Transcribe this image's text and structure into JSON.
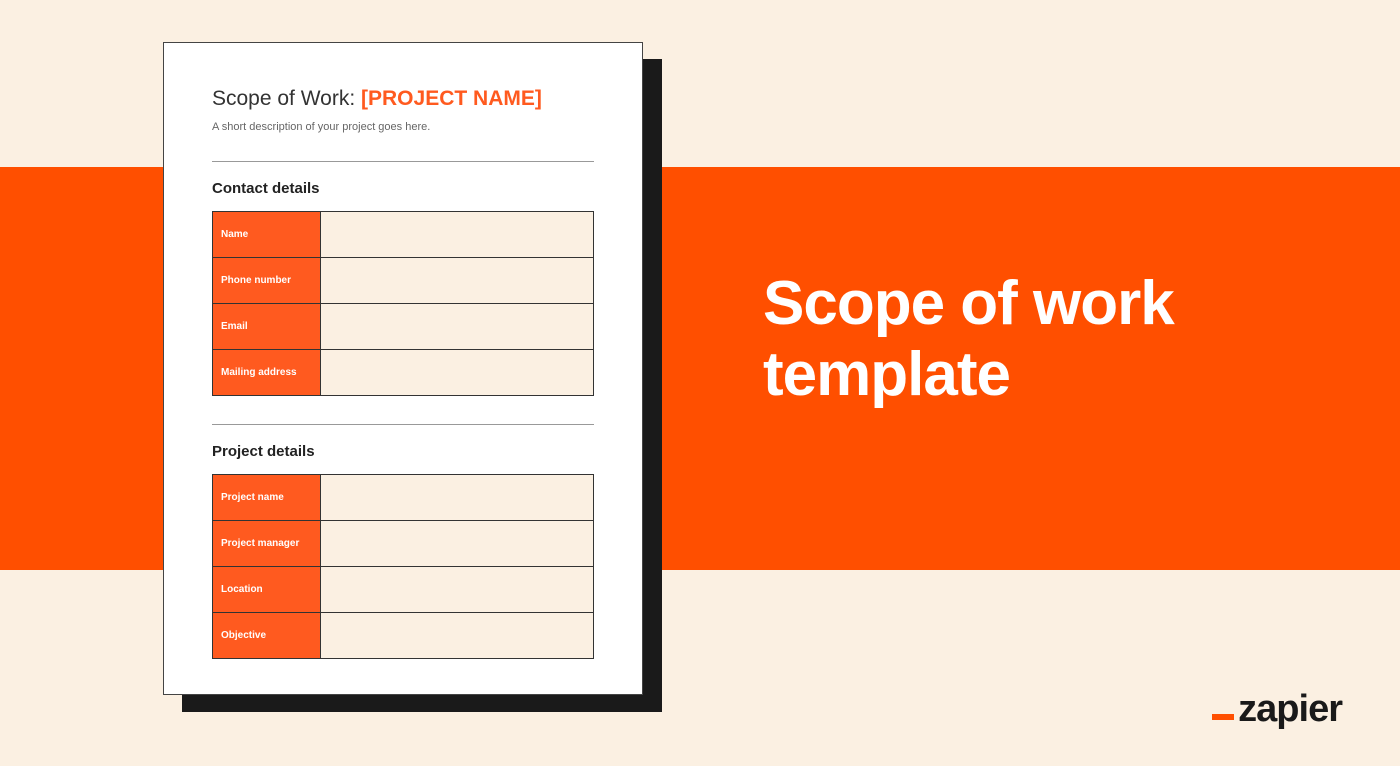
{
  "headline": "Scope of work template",
  "brand": "zapier",
  "document": {
    "title_prefix": "Scope of Work: ",
    "title_placeholder": "[PROJECT NAME]",
    "subtitle": "A short description of your project goes here.",
    "sections": [
      {
        "heading": "Contact details",
        "rows": [
          {
            "label": "Name",
            "value": ""
          },
          {
            "label": "Phone number",
            "value": ""
          },
          {
            "label": "Email",
            "value": ""
          },
          {
            "label": "Mailing address",
            "value": ""
          }
        ]
      },
      {
        "heading": "Project details",
        "rows": [
          {
            "label": "Project name",
            "value": ""
          },
          {
            "label": "Project manager",
            "value": ""
          },
          {
            "label": "Location",
            "value": ""
          },
          {
            "label": "Objective",
            "value": ""
          }
        ]
      }
    ]
  },
  "colors": {
    "bg": "#FBF0E2",
    "accent": "#FF4F00",
    "table_accent": "#FF5A1F",
    "ink": "#1A1A1A"
  }
}
